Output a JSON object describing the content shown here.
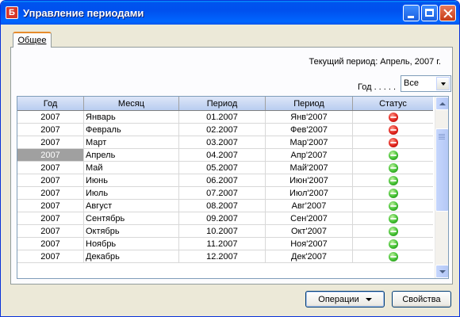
{
  "window": {
    "title": "Управление периодами",
    "icon_letter": "Б",
    "controls": [
      "minimize-icon",
      "maximize-icon",
      "close-icon"
    ]
  },
  "tab": {
    "label": "Общее"
  },
  "current_period": "Текущий период: Апрель, 2007 г.",
  "filter": {
    "label": "Год . . . . .",
    "value": "Все"
  },
  "grid": {
    "columns": [
      "Год",
      "Месяц",
      "Период",
      "Период",
      "Статус"
    ],
    "rows": [
      {
        "year": "2007",
        "month": "Январь",
        "period": "01.2007",
        "period2": "Янв'2007",
        "status": "red"
      },
      {
        "year": "2007",
        "month": "Февраль",
        "period": "02.2007",
        "period2": "Фев'2007",
        "status": "red"
      },
      {
        "year": "2007",
        "month": "Март",
        "period": "03.2007",
        "period2": "Мар'2007",
        "status": "red"
      },
      {
        "year": "2007",
        "month": "Апрель",
        "period": "04.2007",
        "period2": "Апр'2007",
        "status": "green",
        "selected": true
      },
      {
        "year": "2007",
        "month": "Май",
        "period": "05.2007",
        "period2": "Май'2007",
        "status": "green"
      },
      {
        "year": "2007",
        "month": "Июнь",
        "period": "06.2007",
        "period2": "Июн'2007",
        "status": "green"
      },
      {
        "year": "2007",
        "month": "Июль",
        "period": "07.2007",
        "period2": "Июл'2007",
        "status": "green"
      },
      {
        "year": "2007",
        "month": "Август",
        "period": "08.2007",
        "period2": "Авг'2007",
        "status": "green"
      },
      {
        "year": "2007",
        "month": "Сентябрь",
        "period": "09.2007",
        "period2": "Сен'2007",
        "status": "green"
      },
      {
        "year": "2007",
        "month": "Октябрь",
        "period": "10.2007",
        "period2": "Окт'2007",
        "status": "green"
      },
      {
        "year": "2007",
        "month": "Ноябрь",
        "period": "11.2007",
        "period2": "Ноя'2007",
        "status": "green"
      },
      {
        "year": "2007",
        "month": "Декабрь",
        "period": "12.2007",
        "period2": "Дек'2007",
        "status": "green"
      }
    ]
  },
  "buttons": {
    "operations": "Операции",
    "properties": "Свойства"
  },
  "colors": {
    "status_closed": "#e0201a",
    "status_open": "#3fbf2f",
    "titlebar": "#0053ee"
  }
}
